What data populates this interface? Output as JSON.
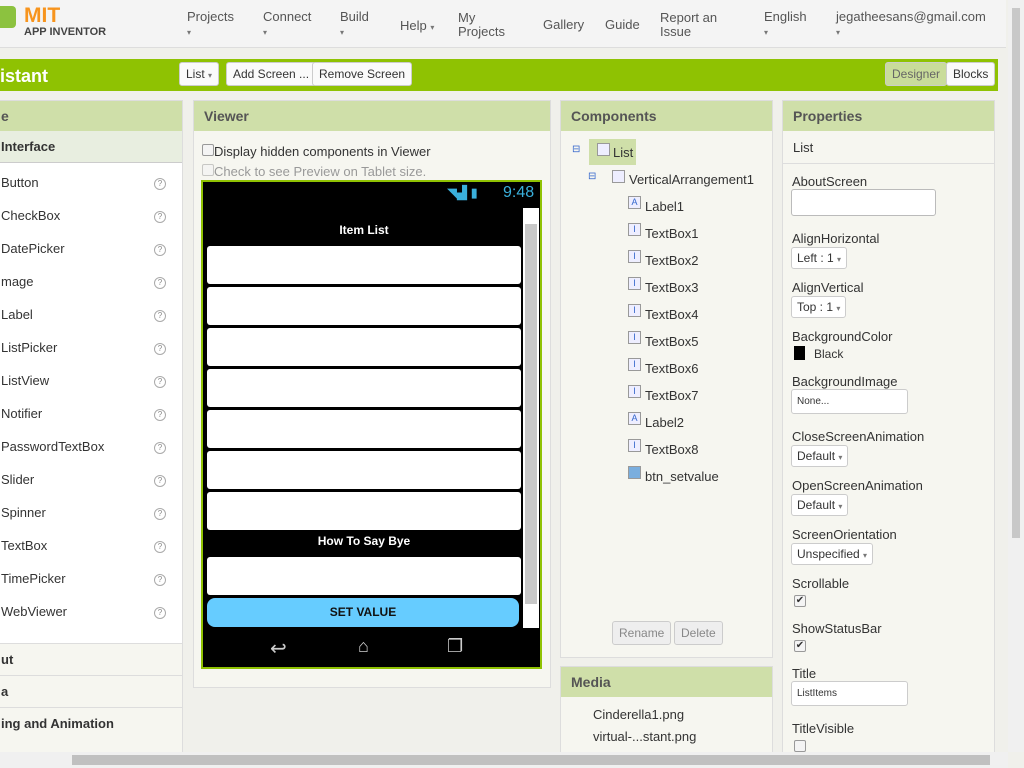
{
  "header": {
    "logo_title": "MIT",
    "logo_subtitle": "APP INVENTOR",
    "nav": [
      "Projects",
      "Connect",
      "Build",
      "Help",
      "My Projects",
      "Gallery",
      "Guide",
      "Report an Issue",
      "English",
      "jegatheesans@gmail.com"
    ]
  },
  "toolbar": {
    "project_title": "istant",
    "screen_select": "List",
    "add_screen": "Add Screen ...",
    "remove_screen": "Remove Screen",
    "designer": "Designer",
    "blocks": "Blocks"
  },
  "palette": {
    "header": "e",
    "section": "Interface",
    "items": [
      "Button",
      "CheckBox",
      "DatePicker",
      "mage",
      "Label",
      "ListPicker",
      "ListView",
      "Notifier",
      "PasswordTextBox",
      "Slider",
      "Spinner",
      "TextBox",
      "TimePicker",
      "WebViewer"
    ],
    "help": "?",
    "sections_below": [
      "ut",
      "a",
      "ing and Animation"
    ]
  },
  "viewer": {
    "header": "Viewer",
    "display_hidden": "Display hidden components in Viewer",
    "tablet_preview": "Check to see Preview on Tablet size.",
    "time": "9:48",
    "label1": "Item List",
    "label2": "How To Say Bye",
    "button": "SET VALUE",
    "accent_color": "#66ccff"
  },
  "components": {
    "header": "Components",
    "root": "List",
    "arrangement": "VerticalArrangement1",
    "children": [
      {
        "name": "Label1",
        "icon": "A"
      },
      {
        "name": "TextBox1",
        "icon": "I"
      },
      {
        "name": "TextBox2",
        "icon": "I"
      },
      {
        "name": "TextBox3",
        "icon": "I"
      },
      {
        "name": "TextBox4",
        "icon": "I"
      },
      {
        "name": "TextBox5",
        "icon": "I"
      },
      {
        "name": "TextBox6",
        "icon": "I"
      },
      {
        "name": "TextBox7",
        "icon": "I"
      },
      {
        "name": "Label2",
        "icon": "A"
      },
      {
        "name": "TextBox8",
        "icon": "I"
      },
      {
        "name": "btn_setvalue",
        "icon": ""
      }
    ],
    "rename": "Rename",
    "delete": "Delete"
  },
  "media": {
    "header": "Media",
    "files": [
      "Cinderella1.png",
      "virtual-...stant.png"
    ]
  },
  "properties": {
    "header": "Properties",
    "component": "List",
    "about_screen": "AboutScreen",
    "align_h": "AlignHorizontal",
    "align_h_val": "Left : 1",
    "align_v": "AlignVertical",
    "align_v_val": "Top : 1",
    "bg_color": "BackgroundColor",
    "bg_color_val": "Black",
    "bg_image": "BackgroundImage",
    "bg_image_val": "None...",
    "close_anim": "CloseScreenAnimation",
    "close_anim_val": "Default",
    "open_anim": "OpenScreenAnimation",
    "open_anim_val": "Default",
    "orientation": "ScreenOrientation",
    "orientation_val": "Unspecified",
    "scrollable": "Scrollable",
    "status_bar": "ShowStatusBar",
    "title": "Title",
    "title_val": "ListItems",
    "title_visible": "TitleVisible",
    "scrollable_checked": true,
    "status_bar_checked": true,
    "title_visible_checked": false
  }
}
